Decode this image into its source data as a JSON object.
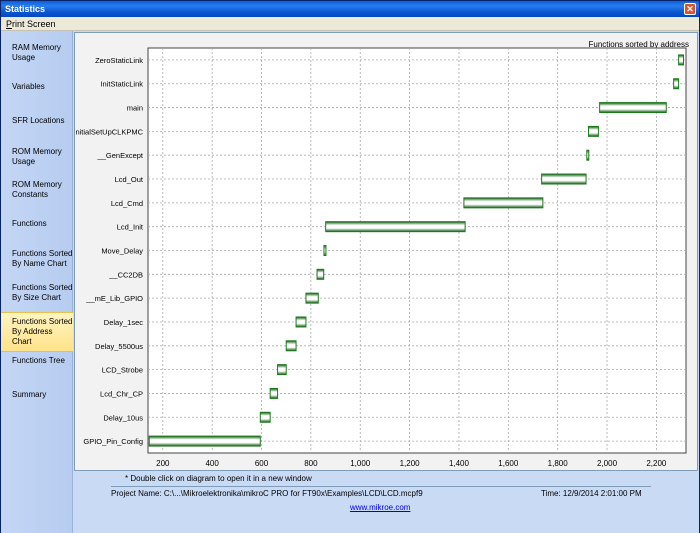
{
  "window": {
    "title": "Statistics"
  },
  "menu": {
    "print_screen": "Print Screen"
  },
  "sidebar": {
    "items": [
      {
        "label": "RAM Memory Usage"
      },
      {
        "label": "Variables"
      },
      {
        "label": "SFR Locations"
      },
      {
        "label": "ROM Memory Usage"
      },
      {
        "label": "ROM Memory Constants"
      },
      {
        "label": "Functions"
      },
      {
        "label": "Functions Sorted By Name Chart"
      },
      {
        "label": "Functions Sorted By Size Chart"
      },
      {
        "label": "Functions Sorted By Address Chart"
      },
      {
        "label": "Functions Tree"
      },
      {
        "label": "Summary"
      }
    ]
  },
  "chart_data": {
    "type": "bar",
    "title": "Functions sorted by address",
    "xlim": [
      140,
      2320
    ],
    "xticks": [
      200,
      400,
      600,
      800,
      1000,
      1200,
      1400,
      1600,
      1800,
      2000,
      2200
    ],
    "xtick_labels": [
      "200",
      "400",
      "600",
      "800",
      "1,000",
      "1,200",
      "1,400",
      "1,600",
      "1,800",
      "2,000",
      "2,200"
    ],
    "grid": true,
    "categories": [
      "ZeroStaticLink",
      "InitStaticLink",
      "main",
      "InitialSetUpCLKPMC",
      "__GenExcept",
      "Lcd_Out",
      "Lcd_Cmd",
      "Lcd_Init",
      "Move_Delay",
      "__CC2DB",
      "__mE_Lib_GPIO",
      "Delay_1sec",
      "Delay_5500us",
      "LCD_Strobe",
      "Lcd_Chr_CP",
      "Delay_10us",
      "GPIO_Pin_Config"
    ],
    "ranges": [
      [
        2290,
        2310
      ],
      [
        2270,
        2290
      ],
      [
        1970,
        2240
      ],
      [
        1925,
        1965
      ],
      [
        1918,
        1924
      ],
      [
        1735,
        1915
      ],
      [
        1420,
        1740
      ],
      [
        860,
        1425
      ],
      [
        853,
        859
      ],
      [
        825,
        852
      ],
      [
        780,
        830
      ],
      [
        740,
        780
      ],
      [
        700,
        740
      ],
      [
        665,
        700
      ],
      [
        635,
        665
      ],
      [
        595,
        635
      ],
      [
        145,
        595
      ]
    ],
    "bar_color": "#1e7a1e"
  },
  "footer": {
    "note": "* Double click on diagram to open it in a new window",
    "project": "Project Name:  C:\\...\\Mikroelektronika\\mikroC PRO for FT90x\\Examples\\LCD\\LCD.mcpf9",
    "time": "Time: 12/9/2014 2:01:00 PM",
    "link": "www.mikroe.com"
  }
}
